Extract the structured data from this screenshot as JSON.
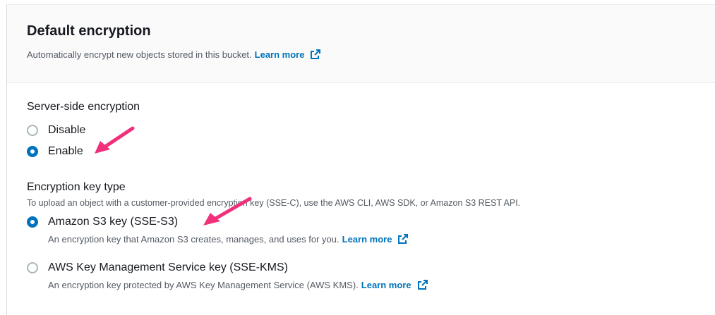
{
  "panel": {
    "title": "Default encryption",
    "description": "Automatically encrypt new objects stored in this bucket.",
    "learn_more": "Learn more"
  },
  "server_side_encryption": {
    "label": "Server-side encryption",
    "options": [
      {
        "label": "Disable",
        "selected": false
      },
      {
        "label": "Enable",
        "selected": true
      }
    ]
  },
  "encryption_key_type": {
    "label": "Encryption key type",
    "hint": "To upload an object with a customer-provided encryption key (SSE-C), use the AWS CLI, AWS SDK, or Amazon S3 REST API.",
    "options": [
      {
        "label": "Amazon S3 key (SSE-S3)",
        "description": "An encryption key that Amazon S3 creates, manages, and uses for you.",
        "learn_more": "Learn more",
        "selected": true
      },
      {
        "label": "AWS Key Management Service key (SSE-KMS)",
        "description": "An encryption key protected by AWS Key Management Service (AWS KMS).",
        "learn_more": "Learn more",
        "selected": false
      }
    ]
  },
  "colors": {
    "accent": "#0073bb",
    "annotation_arrow": "#f0307a"
  }
}
